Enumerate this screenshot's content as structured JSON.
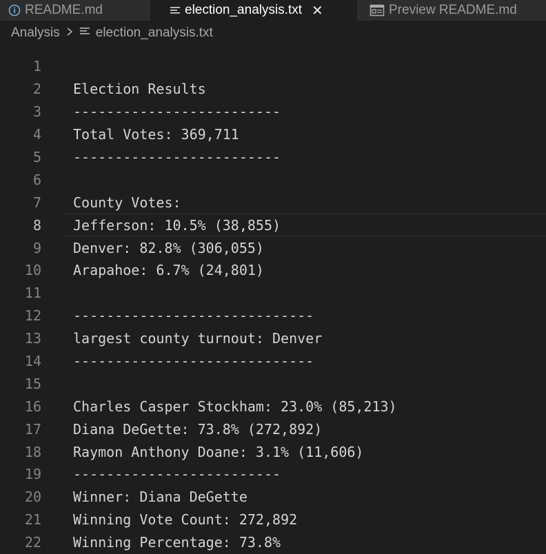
{
  "tabs": [
    {
      "label": "README.md",
      "icon": "info-icon",
      "active": false
    },
    {
      "label": "election_analysis.txt",
      "icon": "text-file-icon",
      "active": true
    },
    {
      "label": "Preview README.md",
      "icon": "preview-icon",
      "active": false
    }
  ],
  "breadcrumb": {
    "folder": "Analysis",
    "file": "election_analysis.txt"
  },
  "current_line": 8,
  "lines": [
    {
      "num": "1",
      "text": ""
    },
    {
      "num": "2",
      "text": "Election Results"
    },
    {
      "num": "3",
      "text": "-------------------------"
    },
    {
      "num": "4",
      "text": "Total Votes: 369,711"
    },
    {
      "num": "5",
      "text": "-------------------------"
    },
    {
      "num": "6",
      "text": ""
    },
    {
      "num": "7",
      "text": "County Votes:"
    },
    {
      "num": "8",
      "text": "Jefferson: 10.5% (38,855)"
    },
    {
      "num": "9",
      "text": "Denver: 82.8% (306,055)"
    },
    {
      "num": "10",
      "text": "Arapahoe: 6.7% (24,801)"
    },
    {
      "num": "11",
      "text": ""
    },
    {
      "num": "12",
      "text": "-----------------------------"
    },
    {
      "num": "13",
      "text": "largest county turnout: Denver"
    },
    {
      "num": "14",
      "text": "-----------------------------"
    },
    {
      "num": "15",
      "text": ""
    },
    {
      "num": "16",
      "text": "Charles Casper Stockham: 23.0% (85,213)"
    },
    {
      "num": "17",
      "text": "Diana DeGette: 73.8% (272,892)"
    },
    {
      "num": "18",
      "text": "Raymon Anthony Doane: 3.1% (11,606)"
    },
    {
      "num": "19",
      "text": "-------------------------"
    },
    {
      "num": "20",
      "text": "Winner: Diana DeGette"
    },
    {
      "num": "21",
      "text": "Winning Vote Count: 272,892"
    },
    {
      "num": "22",
      "text": "Winning Percentage: 73.8%"
    }
  ]
}
